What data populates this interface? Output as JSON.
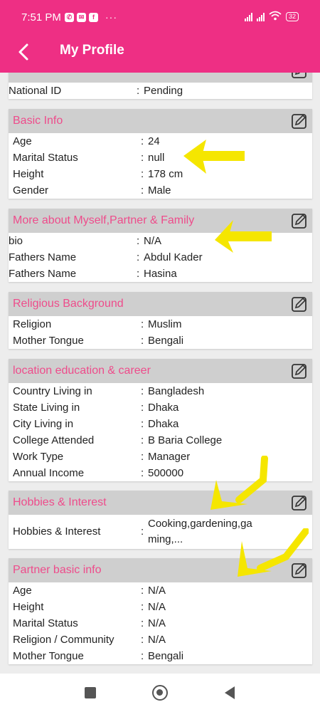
{
  "status_bar": {
    "time": "7:51 PM",
    "notifications": [
      "whatsapp-icon",
      "messenger-icon",
      "facebook-icon"
    ],
    "more": "···",
    "battery": "32"
  },
  "app_bar": {
    "title": "My Profile"
  },
  "sections": {
    "top": {
      "rows": [
        {
          "label": "National ID",
          "value": "Pending"
        }
      ]
    },
    "basic": {
      "title": "Basic Info",
      "rows": [
        {
          "label": "Age",
          "value": "24"
        },
        {
          "label": "Marital Status",
          "value": "null"
        },
        {
          "label": "Height",
          "value": "178 cm"
        },
        {
          "label": "Gender",
          "value": "Male"
        }
      ]
    },
    "more": {
      "title": "More about Myself,Partner & Family",
      "rows": [
        {
          "label": "bio",
          "value": "N/A"
        },
        {
          "label": "Fathers Name",
          "value": "Abdul Kader"
        },
        {
          "label": "Fathers Name",
          "value": "Hasina"
        }
      ]
    },
    "religious": {
      "title": "Religious Background",
      "rows": [
        {
          "label": "Religion",
          "value": "Muslim"
        },
        {
          "label": "Mother Tongue",
          "value": "Bengali"
        }
      ]
    },
    "location": {
      "title": "location education & career",
      "rows": [
        {
          "label": "Country Living in",
          "value": "Bangladesh"
        },
        {
          "label": "State Living in",
          "value": "Dhaka"
        },
        {
          "label": "City Living in",
          "value": "Dhaka"
        },
        {
          "label": "College Attended",
          "value": "B Baria College"
        },
        {
          "label": "Work Type",
          "value": "Manager"
        },
        {
          "label": "Annual Income",
          "value": "500000"
        }
      ]
    },
    "hobbies": {
      "title": "Hobbies & Interest",
      "rows": [
        {
          "label": "Hobbies & Interest",
          "value_line1": "Cooking,gardening,ga",
          "value_line2": "ming,..."
        }
      ]
    },
    "partner": {
      "title": "Partner basic info",
      "rows": [
        {
          "label": "Age",
          "value": "N/A"
        },
        {
          "label": "Height",
          "value": "N/A"
        },
        {
          "label": "Marital Status",
          "value": "N/A"
        },
        {
          "label": "Religion / Community",
          "value": "N/A"
        },
        {
          "label": "Mother Tongue",
          "value": "Bengali"
        }
      ]
    }
  },
  "separator": ":",
  "colors": {
    "accent": "#ee2f84",
    "section_title": "#ee4c8b",
    "section_header_bg": "#cfcfcf",
    "annotation": "#f5e600"
  }
}
